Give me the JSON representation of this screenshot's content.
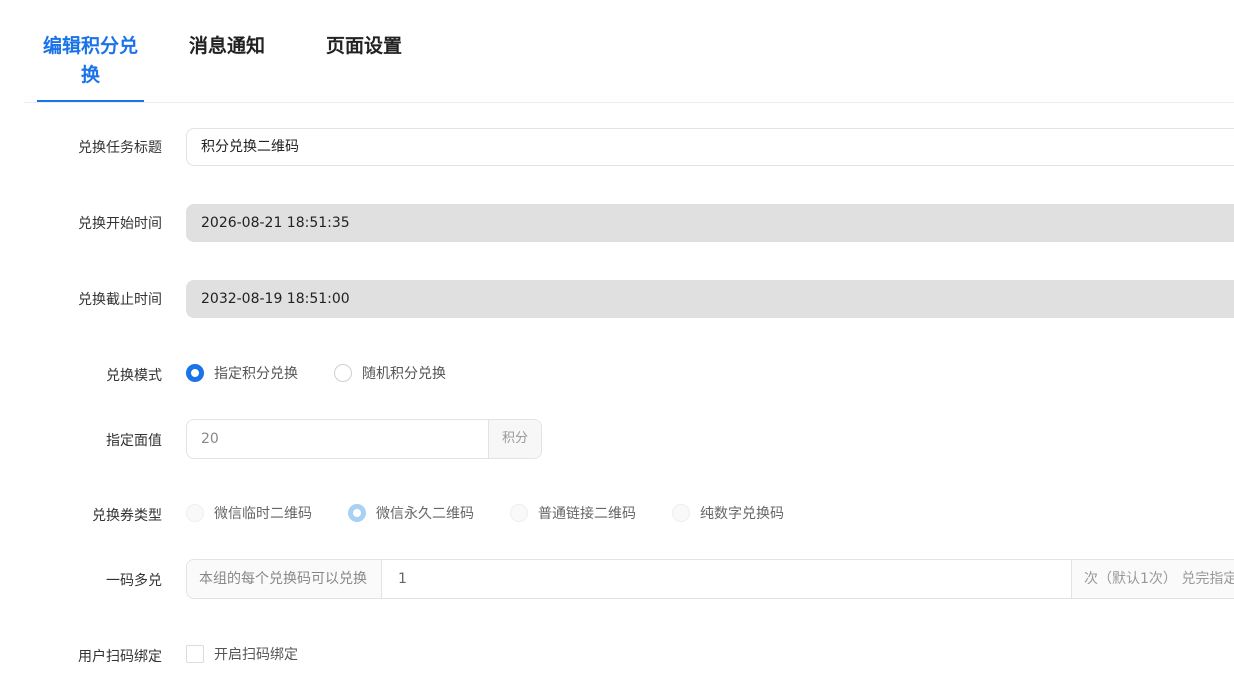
{
  "tabs": [
    {
      "label": "编辑积分兑换",
      "active": true
    },
    {
      "label": "消息通知",
      "active": false
    },
    {
      "label": "页面设置",
      "active": false
    }
  ],
  "form": {
    "title": {
      "label": "兑换任务标题",
      "value": "积分兑换二维码"
    },
    "start": {
      "label": "兑换开始时间",
      "value": "2026-08-21 18:51:35"
    },
    "end": {
      "label": "兑换截止时间",
      "value": "2032-08-19 18:51:00"
    },
    "mode": {
      "label": "兑换模式",
      "options": [
        "指定积分兑换",
        "随机积分兑换"
      ],
      "selected": "指定积分兑换"
    },
    "face_value": {
      "label": "指定面值",
      "value": "20",
      "unit": "积分"
    },
    "voucher_type": {
      "label": "兑换券类型",
      "options": [
        "微信临时二维码",
        "微信永久二维码",
        "普通链接二维码",
        "纯数字兑换码"
      ],
      "selected": "微信永久二维码"
    },
    "multi_redeem": {
      "label": "一码多兑",
      "prefix": "本组的每个兑换码可以兑换",
      "value": "1",
      "suffix": "次（默认1次） 兑完指定"
    },
    "scan_bind": {
      "label": "用户扫码绑定",
      "option": "开启扫码绑定",
      "checked": false
    }
  },
  "colors": {
    "accent": "#1a73e8",
    "disabled_bg": "#e0e0e0"
  }
}
